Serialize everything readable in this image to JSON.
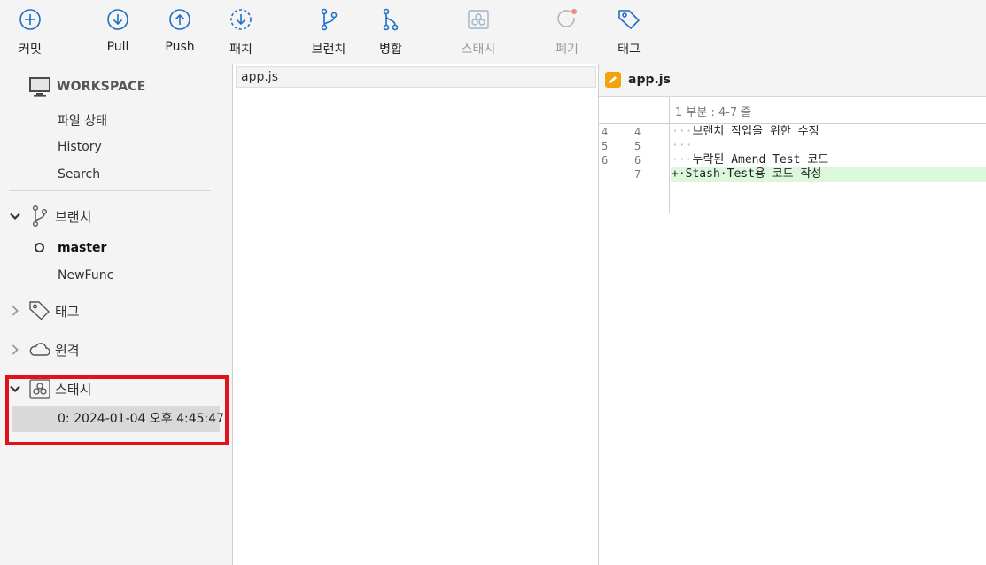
{
  "toolbar": {
    "commit": "커밋",
    "pull": "Pull",
    "push": "Push",
    "patch": "패치",
    "branch": "브랜치",
    "merge": "병합",
    "stash": "스태시",
    "discard": "폐기",
    "tag": "태그"
  },
  "sidebar": {
    "workspace_title": "WORKSPACE",
    "workspace_items": [
      "파일 상태",
      "History",
      "Search"
    ],
    "branches_label": "브랜치",
    "branches": [
      "master",
      "NewFunc"
    ],
    "tags_label": "태그",
    "remotes_label": "원격",
    "stashes_label": "스태시",
    "stash_entries": [
      "0: 2024-01-04 오후 4:45:47"
    ]
  },
  "file_list": {
    "files": [
      "app.js"
    ]
  },
  "diff": {
    "filename": "app.js",
    "hunk_title": "1 부분 : 4-7 줄",
    "lines": [
      {
        "old": "4",
        "new": "4",
        "dots": "···",
        "text": "브랜치 작업을 위한 수정"
      },
      {
        "old": "5",
        "new": "5",
        "dots": "···",
        "text": ""
      },
      {
        "old": "6",
        "new": "6",
        "dots": "···",
        "text": "누락된 Amend Test 코드"
      },
      {
        "old": "",
        "new": "7",
        "dots": "+·",
        "text": "Stash·Test용 코드 작성"
      }
    ]
  },
  "colors": {
    "highlight": "#e0121b",
    "icon_blue": "#1f6fc5",
    "added_bg": "#dcf8dc"
  }
}
